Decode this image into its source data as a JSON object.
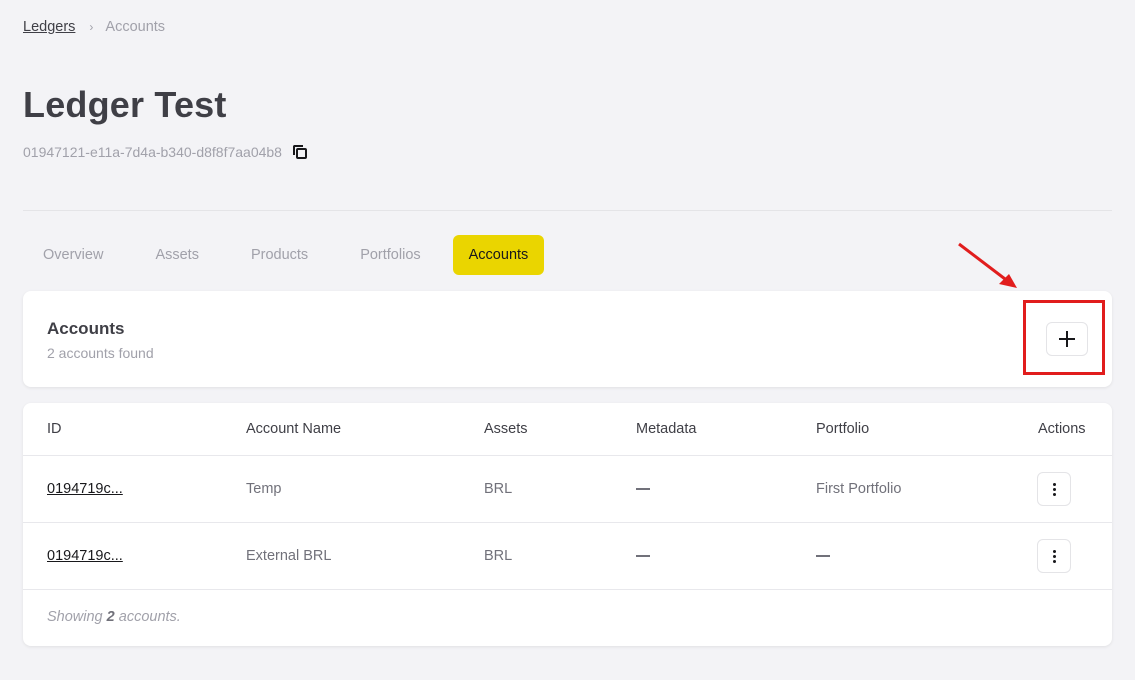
{
  "breadcrumb": {
    "items": [
      {
        "label": "Ledgers"
      },
      {
        "label": "Accounts"
      }
    ],
    "separator": "›"
  },
  "page": {
    "title": "Ledger Test",
    "ledger_id": "01947121-e11a-7d4a-b340-d8f8f7aa04b8"
  },
  "tabs": [
    {
      "label": "Overview",
      "active": false
    },
    {
      "label": "Assets",
      "active": false
    },
    {
      "label": "Products",
      "active": false
    },
    {
      "label": "Portfolios",
      "active": false
    },
    {
      "label": "Accounts",
      "active": true
    }
  ],
  "accounts_card": {
    "title": "Accounts",
    "subtitle": "2 accounts found",
    "add_icon": "plus-icon"
  },
  "table": {
    "columns": [
      "ID",
      "Account Name",
      "Assets",
      "Metadata",
      "Portfolio",
      "Actions"
    ],
    "rows": [
      {
        "id": "0194719c...",
        "name": "Temp",
        "assets": "BRL",
        "metadata": "—",
        "portfolio": "First Portfolio"
      },
      {
        "id": "0194719c...",
        "name": "External BRL",
        "assets": "BRL",
        "metadata": "—",
        "portfolio": "—"
      }
    ],
    "footer": {
      "prefix": "Showing ",
      "count": "2",
      "suffix": " accounts."
    }
  },
  "colors": {
    "accent": "#ead500",
    "annotation": "#e11d1d",
    "background": "#f3f3f6"
  }
}
